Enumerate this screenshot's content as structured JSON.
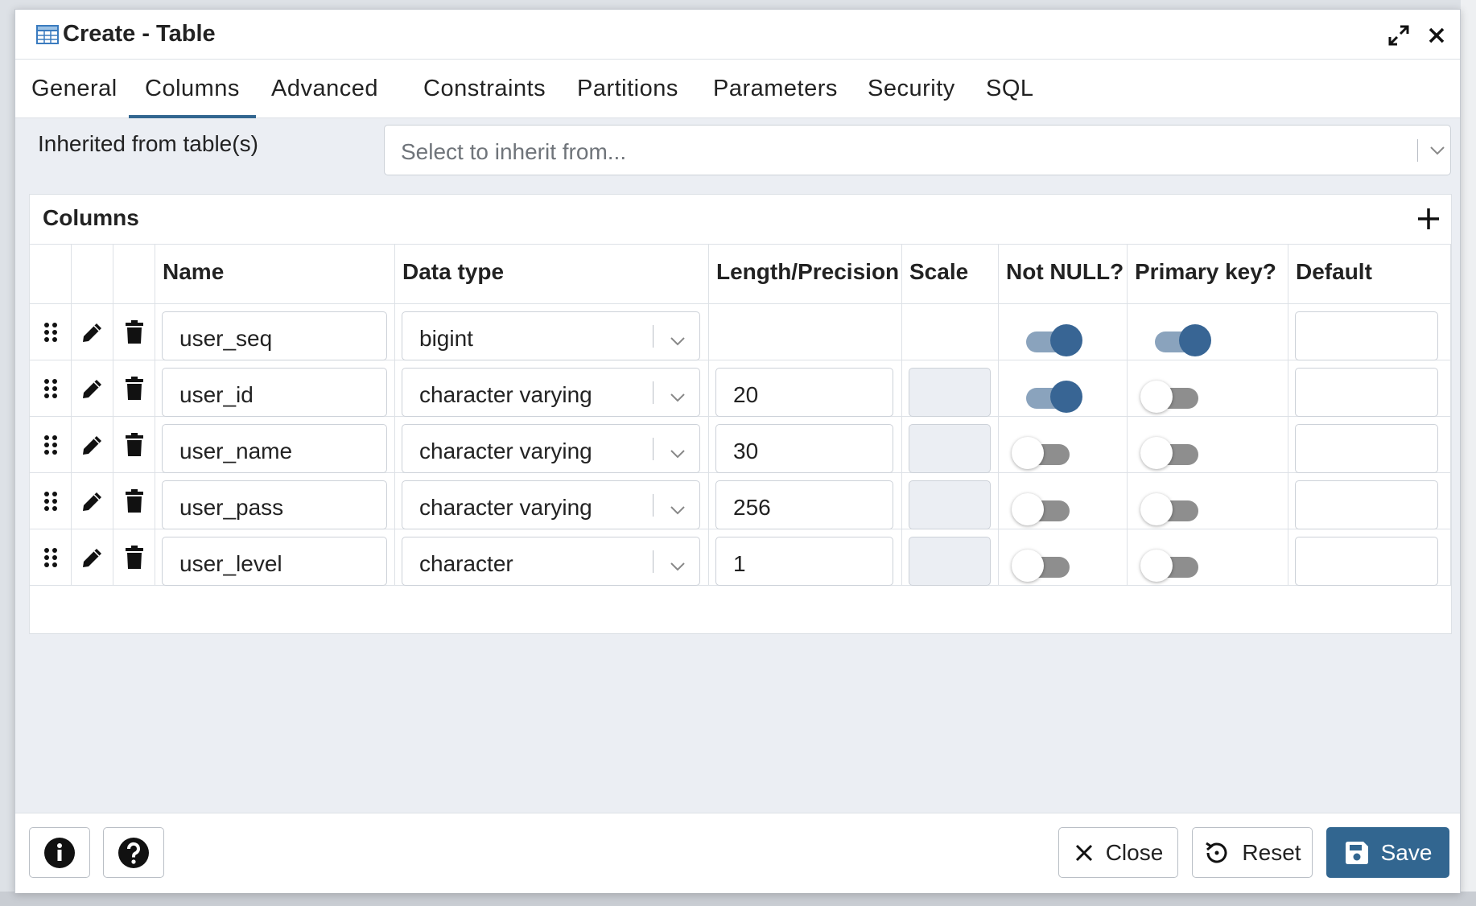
{
  "dialog": {
    "title": "Create - Table",
    "icons": {
      "title": "table-icon",
      "expand": "expand-icon",
      "close": "close-icon"
    }
  },
  "tabs": [
    {
      "label": "General"
    },
    {
      "label": "Columns",
      "active": true
    },
    {
      "label": "Advanced"
    },
    {
      "label": "Constraints"
    },
    {
      "label": "Partitions"
    },
    {
      "label": "Parameters"
    },
    {
      "label": "Security"
    },
    {
      "label": "SQL"
    }
  ],
  "inherit": {
    "label": "Inherited from table(s)",
    "placeholder": "Select to inherit from..."
  },
  "columns_panel": {
    "title": "Columns",
    "headers": {
      "name": "Name",
      "data_type": "Data type",
      "length": "Length/Precision",
      "scale": "Scale",
      "not_null": "Not NULL?",
      "primary_key": "Primary key?",
      "default": "Default"
    },
    "rows": [
      {
        "name": "user_seq",
        "data_type": "bigint",
        "length": "",
        "scale": "",
        "not_null": true,
        "primary_key": true,
        "default": ""
      },
      {
        "name": "user_id",
        "data_type": "character varying",
        "length": "20",
        "scale": "",
        "not_null": true,
        "primary_key": false,
        "default": ""
      },
      {
        "name": "user_name",
        "data_type": "character varying",
        "length": "30",
        "scale": "",
        "not_null": false,
        "primary_key": false,
        "default": ""
      },
      {
        "name": "user_pass",
        "data_type": "character varying",
        "length": "256",
        "scale": "",
        "not_null": false,
        "primary_key": false,
        "default": ""
      },
      {
        "name": "user_level",
        "data_type": "character",
        "length": "1",
        "scale": "",
        "not_null": false,
        "primary_key": false,
        "default": ""
      }
    ]
  },
  "footer": {
    "close_label": "Close",
    "reset_label": "Reset",
    "save_label": "Save"
  },
  "colors": {
    "primary": "#326690",
    "toggle_on_track": "#8aa3bd",
    "toggle_on_knob": "#386594",
    "toggle_off_track": "#8e8e8e"
  }
}
